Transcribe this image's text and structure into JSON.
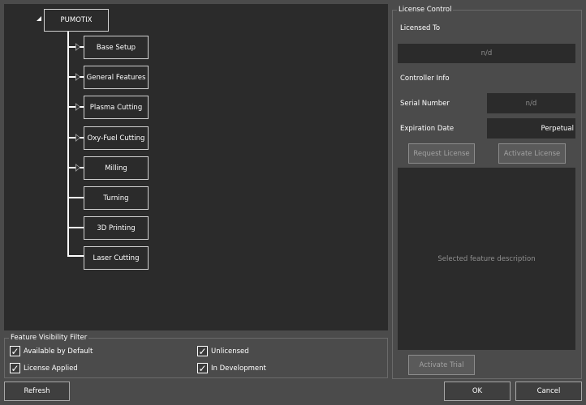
{
  "tree": {
    "root": {
      "label": "PUMOTIX"
    },
    "children": [
      {
        "label": "Base Setup",
        "expandable": true
      },
      {
        "label": "General Features",
        "expandable": true
      },
      {
        "label": "Plasma Cutting",
        "expandable": true
      },
      {
        "label": "Oxy-Fuel Cutting",
        "expandable": true
      },
      {
        "label": "Milling",
        "expandable": true
      },
      {
        "label": "Turning",
        "expandable": false
      },
      {
        "label": "3D Printing",
        "expandable": false
      },
      {
        "label": "Laser Cutting",
        "expandable": false
      }
    ]
  },
  "filter": {
    "title": "Feature Visibility Filter",
    "options": [
      {
        "label": "Available by Default",
        "checked": true
      },
      {
        "label": "Unlicensed",
        "checked": true
      },
      {
        "label": "License Applied",
        "checked": true
      },
      {
        "label": "In Development",
        "checked": true
      }
    ]
  },
  "license": {
    "title": "License Control",
    "licensed_to_label": "Licensed To",
    "licensed_to_value": "n/d",
    "controller_info_label": "Controller Info",
    "serial_number_label": "Serial Number",
    "serial_number_value": "n/d",
    "expiration_date_label": "Expiration Date",
    "expiration_date_value": "Perpetual",
    "request_license_label": "Request License",
    "activate_license_label": "Activate License",
    "description_placeholder": "Selected feature description",
    "activate_trial_label": "Activate Trial"
  },
  "footer": {
    "refresh_label": "Refresh",
    "ok_label": "OK",
    "cancel_label": "Cancel"
  },
  "colors": {
    "window_bg": "#4b4b4b",
    "panel_bg": "#2b2b2b",
    "text": "#ffffff",
    "disabled_text": "#a2a2a2"
  },
  "icons": {
    "root_expanded": "collapse-triangle-icon",
    "child_collapsed": "expand-triangle-icon",
    "checkbox": "checkmark-icon"
  }
}
